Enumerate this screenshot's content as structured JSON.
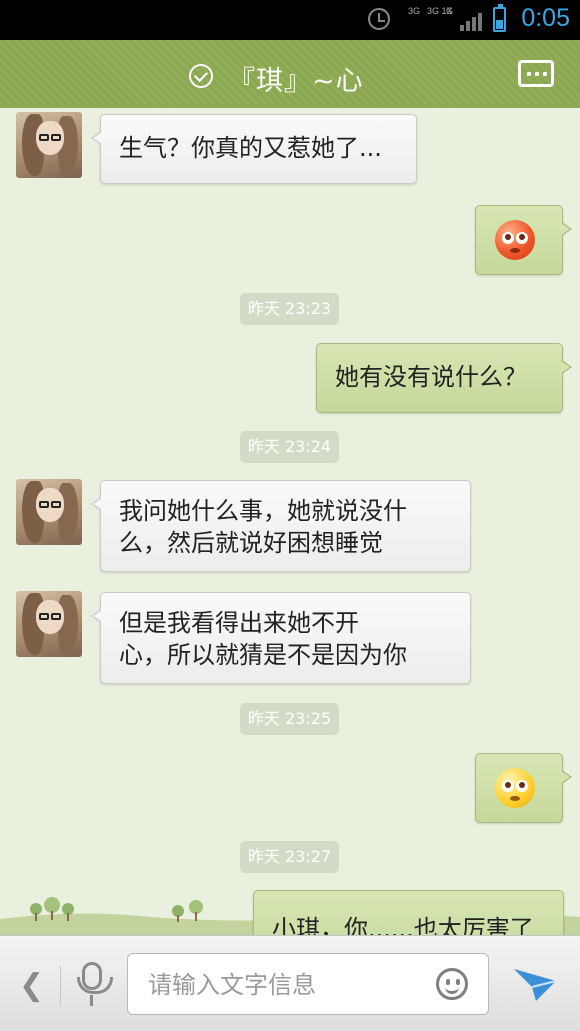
{
  "status_bar": {
    "time": "0:05",
    "network_a": "3G",
    "network_b": "3G 1X",
    "network_c": "G",
    "alarm_icon": "alarm-clock-icon",
    "battery_icon": "battery-icon",
    "accent": "#39a7e6"
  },
  "header": {
    "title": "『琪』~心",
    "status_icon": "check-circle-icon",
    "menu_icon": "more-options-icon",
    "background": "#8ea853"
  },
  "messages": [
    {
      "side": "in",
      "type": "text",
      "text": "生气？你真的又惹她了..."
    },
    {
      "side": "out",
      "type": "emoji",
      "emoji": "red-blush-emoji"
    },
    {
      "type": "time",
      "text": "昨天 23:23"
    },
    {
      "side": "out",
      "type": "text",
      "text": "她有没有说什么？"
    },
    {
      "type": "time",
      "text": "昨天 23:24"
    },
    {
      "side": "in",
      "type": "text",
      "lines": [
        "我问她什么事，她就说没什",
        "么，然后就说好困想睡觉"
      ]
    },
    {
      "side": "in",
      "type": "text",
      "lines": [
        "但是我看得出来她不开",
        "心，所以就猜是不是因为你"
      ]
    },
    {
      "type": "time",
      "text": "昨天 23:25"
    },
    {
      "side": "out",
      "type": "emoji",
      "emoji": "sweat-emoji"
    },
    {
      "type": "time",
      "text": "昨天 23:27"
    },
    {
      "side": "out",
      "type": "text",
      "text": "小琪，你......也太厉害了"
    }
  ],
  "input_bar": {
    "placeholder": "请输入文字信息",
    "back_icon": "chevron-left-icon",
    "voice_icon": "microphone-icon",
    "emoji_icon": "smiley-icon",
    "send_icon": "send-icon",
    "send_color": "#3b8fd6"
  }
}
